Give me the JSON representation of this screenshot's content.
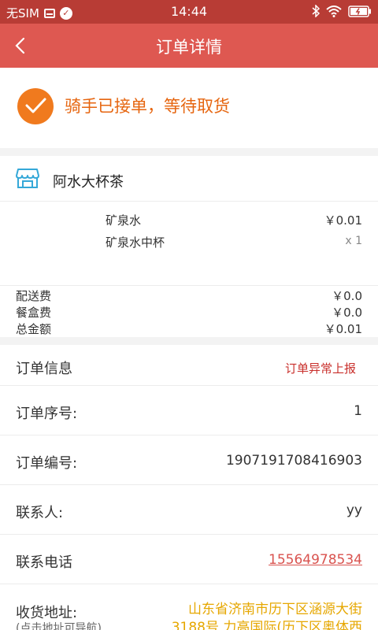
{
  "status_bar": {
    "carrier": "无SIM",
    "time": "14:44"
  },
  "nav": {
    "title": "订单详情"
  },
  "order_status": {
    "text": "骑手已接单，等待取货",
    "color": "#f07a1e"
  },
  "shop": {
    "name": "阿水大杯茶"
  },
  "items": [
    {
      "name": "矿泉水",
      "price": "￥0.01"
    },
    {
      "name": "矿泉水中杯",
      "qty": "x 1"
    }
  ],
  "fees": [
    {
      "label": "配送费",
      "value": "￥0.0"
    },
    {
      "label": "餐盒费",
      "value": "￥0.0"
    },
    {
      "label": "总金额",
      "value": "￥0.01"
    }
  ],
  "info": {
    "header": "订单信息",
    "report": "订单异常上报",
    "seq_label": "订单序号:",
    "seq_value": "1",
    "number_label": "订单编号:",
    "number_value": "1907191708416903",
    "contact_label": "联系人:",
    "contact_value": "yy",
    "phone_label": "联系电话",
    "phone_value": "15564978534",
    "address_label": "收货地址:",
    "address_hint": "(点击地址可导航)",
    "address_line1": "山东省济南市历下区涵源大街",
    "address_line2": "3188号 力高国际(历下区奥体西"
  },
  "colors": {
    "status_bar": "#b83c35",
    "nav_bar": "#de5851",
    "status_text": "#e6650f",
    "report_link": "#c9302c",
    "address": "#e6a700"
  }
}
